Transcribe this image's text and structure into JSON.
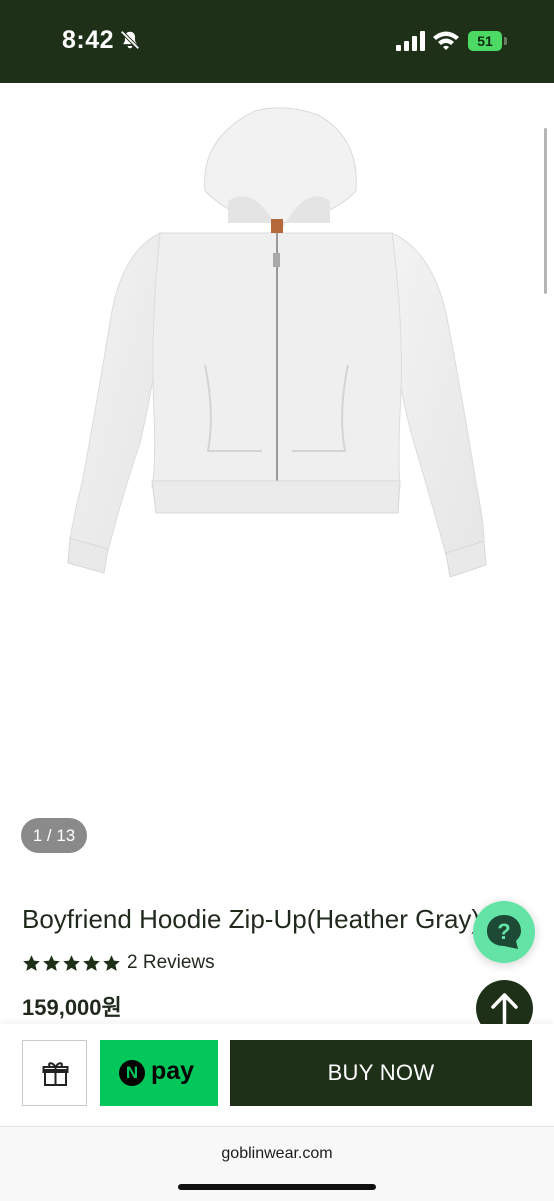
{
  "status_bar": {
    "time": "8:42",
    "battery_level": "51",
    "background_color": "#1f3019"
  },
  "product": {
    "image_counter": "1 / 13",
    "title": "Boyfriend Hoodie Zip-Up(Heather Gray)",
    "rating_stars": 5,
    "reviews": "2 Reviews",
    "price": "159,000원"
  },
  "actions": {
    "npay_logo_letter": "N",
    "npay_label": "pay",
    "buy_now_label": "BUY NOW"
  },
  "browser": {
    "url": "goblinwear.com"
  },
  "colors": {
    "brand_dark_green": "#1f3019",
    "npay_green": "#03c75a",
    "help_mint": "#63e3a5",
    "battery_green": "#4cd964"
  },
  "icons": [
    "bell-slash-icon",
    "signal-icon",
    "wifi-icon",
    "battery-icon",
    "star-icon",
    "help-chat-icon",
    "arrow-up-icon",
    "gift-icon"
  ]
}
